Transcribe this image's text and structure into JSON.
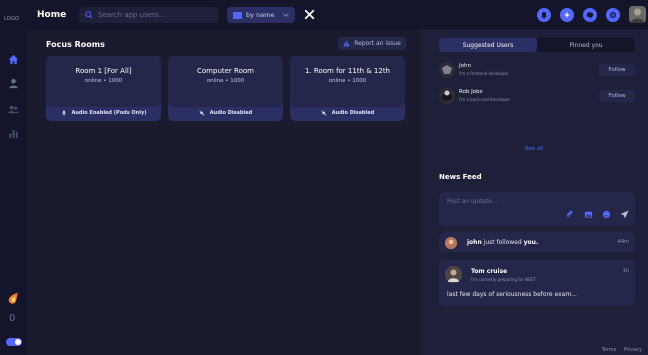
{
  "rail": {
    "logo": "LOGO",
    "streak_count": "0"
  },
  "topbar": {
    "title": "Home",
    "search_placeholder": "Search app users...",
    "sort_label": "by name"
  },
  "main": {
    "section_title": "Focus Rooms",
    "report_label": "Report an issue",
    "rooms": [
      {
        "name": "Room 1 [For All]",
        "status": "online • 1000",
        "audio": "Audio Enabled (Pods Only)"
      },
      {
        "name": "Computer Room",
        "status": "online • 1000",
        "audio": "Audio Disabled"
      },
      {
        "name": "1. Room for 11th & 12th",
        "status": "online • 1000",
        "audio": "Audio Disabled"
      }
    ]
  },
  "panel": {
    "tabs": [
      "Suggested Users",
      "Pinned you"
    ],
    "users": [
      {
        "name": "John",
        "bio": "I'm a frontend developer",
        "follow": "Follow"
      },
      {
        "name": "Rob Jobs",
        "bio": "I'm a back-end developer",
        "follow": "Follow"
      }
    ],
    "see_all": "See all",
    "news_title": "News Feed",
    "post_placeholder": "Post an update...",
    "activity": {
      "actor": "john",
      "action": "just followed",
      "target": "you.",
      "time": "44m"
    },
    "post": {
      "author": "Tom cruise",
      "bio": "I'm currently preparing for NEET",
      "time": "1h",
      "body": "last few days of seriousness before exam..."
    }
  },
  "footer": {
    "terms": "Terms",
    "privacy": "Privacy"
  },
  "colors": {
    "accent": "#5468ff",
    "bg": "#1a1b2e",
    "panel": "#1e1f38",
    "card": "#25274a"
  }
}
